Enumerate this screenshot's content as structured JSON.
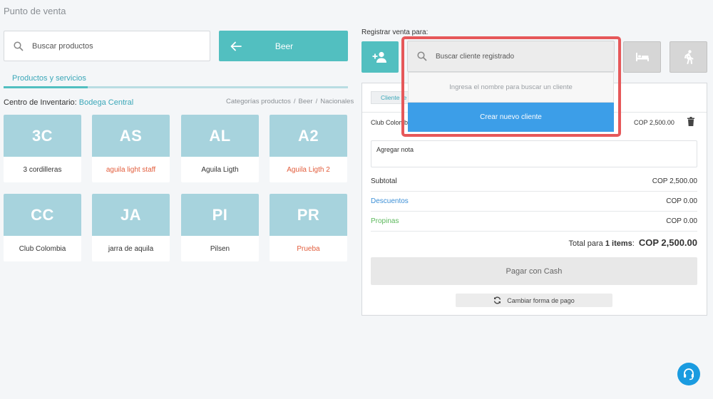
{
  "page": {
    "title": "Punto de venta"
  },
  "products_panel": {
    "search_placeholder": "Buscar productos",
    "category_button": "Beer",
    "tab_label": "Productos y servicios",
    "inventory_label": "Centro de Inventario: ",
    "inventory_link": "Bodega Central",
    "breadcrumb": [
      "Categorías productos",
      "Beer",
      "Nacionales"
    ],
    "products": [
      {
        "code": "3C",
        "name": "3 cordilleras",
        "highlight": false
      },
      {
        "code": "AS",
        "name": "aguila light staff",
        "highlight": true
      },
      {
        "code": "AL",
        "name": "Aguila Ligth",
        "highlight": false
      },
      {
        "code": "A2",
        "name": "Aguila Ligth 2",
        "highlight": true
      },
      {
        "code": "CC",
        "name": "Club Colombia",
        "highlight": false
      },
      {
        "code": "JA",
        "name": "jarra de aquila",
        "highlight": false
      },
      {
        "code": "PI",
        "name": "Pilsen",
        "highlight": false
      },
      {
        "code": "PR",
        "name": "Prueba",
        "highlight": true
      }
    ]
  },
  "sale_panel": {
    "register_label": "Registrar venta para:",
    "client_search_placeholder": "Buscar cliente registrado",
    "dropdown_hint": "Ingresa el nombre para buscar un cliente",
    "create_client": "Crear nuevo cliente",
    "client_tab": "Cliente re",
    "item": {
      "name": "Club Colomb",
      "price": "COP 2,500.00"
    },
    "note_placeholder": "Agregar nota",
    "subtotal_label": "Subtotal",
    "subtotal_value": "COP 2,500.00",
    "discounts_label": "Descuentos",
    "discounts_value": "COP 0.00",
    "tips_label": "Propinas",
    "tips_value": "COP 0.00",
    "total_prefix": "Total para ",
    "total_items": "1 items",
    "total_colon": ":",
    "total_value": "COP 2,500.00",
    "pay_button": "Pagar con Cash",
    "change_payment": "Cambiar forma de pago"
  },
  "colors": {
    "accent": "#52bfc0",
    "tile": "#a7d3dd",
    "highlight_text": "#e25d3c",
    "create_button": "#3c9ee8",
    "highlight_box": "#e6585a",
    "discounts": "#3c8fd6",
    "tips": "#5cb85c"
  },
  "icons": [
    "search-icon",
    "arrow-left-icon",
    "add-user-icon",
    "bed-icon",
    "walking-icon",
    "trash-icon",
    "refresh-icon",
    "headset-icon"
  ]
}
